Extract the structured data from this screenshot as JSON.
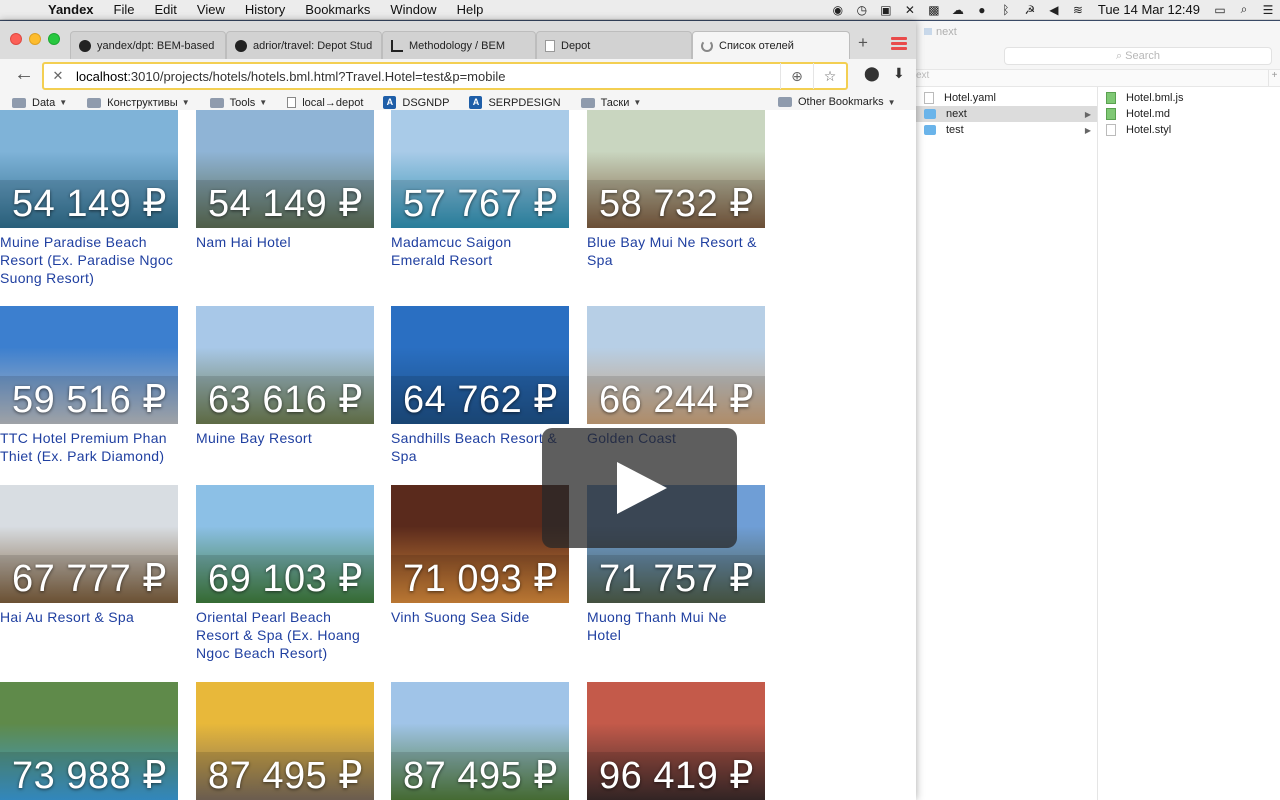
{
  "menubar": {
    "app": "Yandex",
    "items": [
      "File",
      "Edit",
      "View",
      "History",
      "Bookmarks",
      "Window",
      "Help"
    ],
    "clock": "Tue 14 Mar  12:49"
  },
  "browser": {
    "tabs": [
      {
        "label": "yandex/dpt: BEM-based",
        "icon": "github-icon"
      },
      {
        "label": "adrior/travel: Depot Stud",
        "icon": "github-icon"
      },
      {
        "label": "Methodology / BEM",
        "icon": "bem-icon"
      },
      {
        "label": "Depot",
        "icon": "page-icon"
      },
      {
        "label": "Список отелей",
        "icon": "loading-icon"
      }
    ],
    "url_host": "localhost",
    "url_rest": ":3010/projects/hotels/hotels.bml.html?Travel.Hotel=test&p=mobile",
    "bookmarks": [
      {
        "label": "Data",
        "type": "folder",
        "menu": true
      },
      {
        "label": "Конструктивы",
        "type": "folder",
        "menu": true
      },
      {
        "label": "Tools",
        "type": "folder",
        "menu": true
      },
      {
        "label": "local→depot",
        "type": "page",
        "menu": false
      },
      {
        "label": "DSGNDP",
        "type": "app",
        "menu": false
      },
      {
        "label": "SERPDESIGN",
        "type": "app",
        "menu": false
      },
      {
        "label": "Таски",
        "type": "folder",
        "menu": true
      }
    ],
    "other_bookmarks": "Other Bookmarks"
  },
  "hotels": [
    {
      "name": "Muine Paradise Beach Resort (Ex. Paradise Ngoc Suong Resort)",
      "price": "54 149 ₽",
      "c1": "#7fb3d8",
      "c2": "#2f6d8c"
    },
    {
      "name": "Nam Hai Hotel",
      "price": "54 149 ₽",
      "c1": "#8fb4d6",
      "c2": "#5a6b52"
    },
    {
      "name": "Madamcuc Saigon Emerald Resort",
      "price": "57 767 ₽",
      "c1": "#a9cbe8",
      "c2": "#2e8fb0"
    },
    {
      "name": "Blue Bay Mui Ne Resort & Spa",
      "price": "58 732 ₽",
      "c1": "#c9d6c0",
      "c2": "#7a5a3e"
    },
    {
      "name": "TTC Hotel Premium Phan Thiet (Ex. Park Diamond)",
      "price": "59 516 ₽",
      "c1": "#3c7fcf",
      "c2": "#b5b9bf"
    },
    {
      "name": "Muine Bay Resort",
      "price": "63 616 ₽",
      "c1": "#a8c8e8",
      "c2": "#6b7a4e"
    },
    {
      "name": "Sandhills Beach Resort & Spa",
      "price": "64 762 ₽",
      "c1": "#2a6fc2",
      "c2": "#1d4f84"
    },
    {
      "name": "Golden Coast",
      "price": "66 244 ₽",
      "c1": "#b7cfe6",
      "c2": "#c7a078"
    },
    {
      "name": "Hai Au Resort & Spa",
      "price": "67 777 ₽",
      "c1": "#d8dde2",
      "c2": "#7a5c3a"
    },
    {
      "name": "Oriental Pearl Beach Resort & Spa (Ex. Hoang Ngoc Beach Resort)",
      "price": "69 103 ₽",
      "c1": "#8cc0e6",
      "c2": "#3d7a3a"
    },
    {
      "name": "Vinh Suong Sea Side",
      "price": "71 093 ₽",
      "c1": "#5a2a1c",
      "c2": "#d4883a"
    },
    {
      "name": "Muong Thanh Mui Ne Hotel",
      "price": "71 757 ₽",
      "c1": "#6f9ed6",
      "c2": "#4d5c48"
    },
    {
      "name": "",
      "price": "73 988 ₽",
      "c1": "#5f8a4a",
      "c2": "#3a9ad6"
    },
    {
      "name": "",
      "price": "87 495 ₽",
      "c1": "#e8b83a",
      "c2": "#7a6a5a"
    },
    {
      "name": "",
      "price": "87 495 ₽",
      "c1": "#a0c4e8",
      "c2": "#4f7a3a"
    },
    {
      "name": "",
      "price": "96 419 ₽",
      "c1": "#c45a4a",
      "c2": "#3a2a2a"
    }
  ],
  "finder": {
    "title": "next",
    "search_placeholder": "Search",
    "header": "ext",
    "col1": [
      {
        "label": "Hotel.yaml",
        "type": "doc",
        "selected": false,
        "arrow": false
      },
      {
        "label": "next",
        "type": "folder",
        "selected": true,
        "arrow": true
      },
      {
        "label": "test",
        "type": "folder",
        "selected": false,
        "arrow": true
      }
    ],
    "col2": [
      {
        "label": "Hotel.bml.js",
        "type": "green"
      },
      {
        "label": "Hotel.md",
        "type": "green"
      },
      {
        "label": "Hotel.styl",
        "type": "doc"
      }
    ]
  }
}
